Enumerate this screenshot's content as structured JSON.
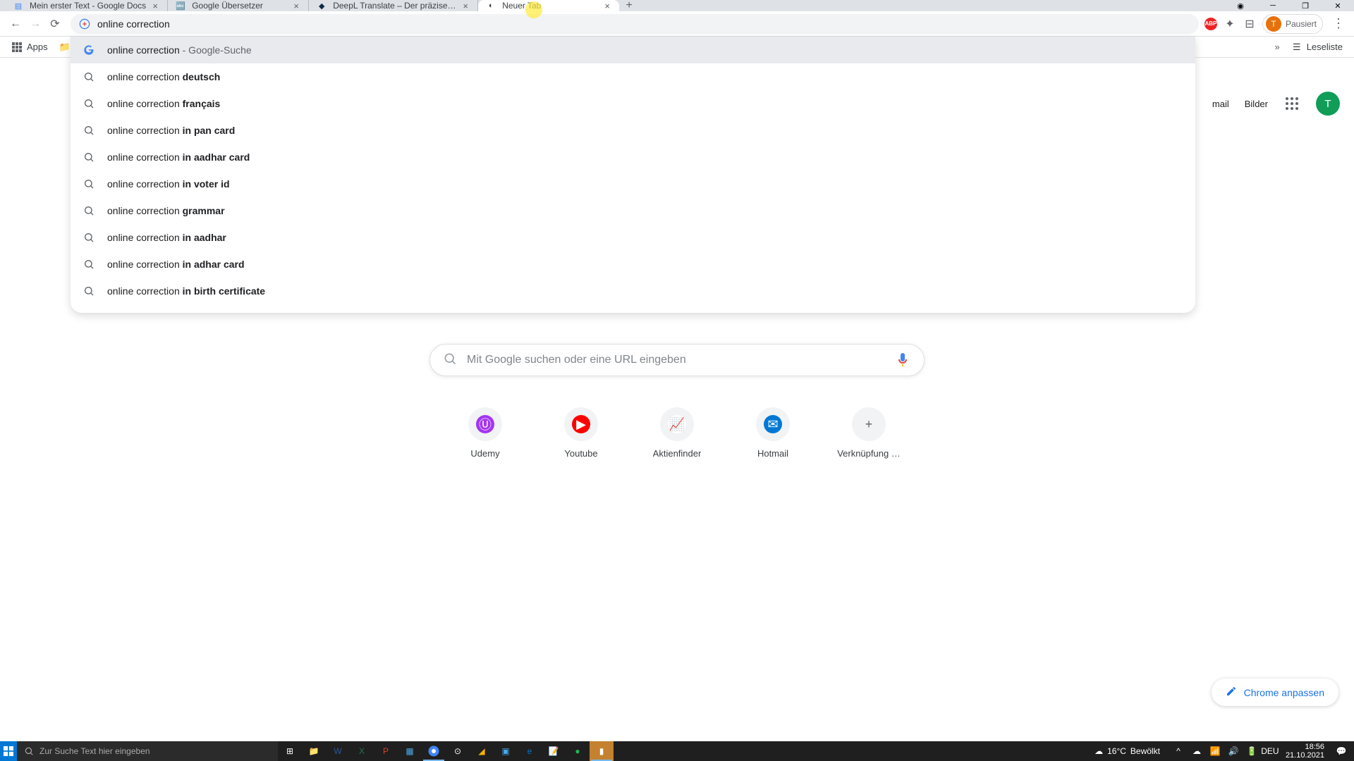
{
  "tabs": [
    {
      "title": "Mein erster Text - Google Docs",
      "favicon": "📄",
      "color": "#4285f4"
    },
    {
      "title": "Google Übersetzer",
      "favicon": "🔄",
      "color": "#4285f4"
    },
    {
      "title": "DeepL Translate – Der präziseste",
      "favicon": "◆",
      "color": "#0f2b46"
    },
    {
      "title": "Neuer Tab",
      "favicon": "G",
      "color": "#5f6368",
      "active": true
    }
  ],
  "address": {
    "value": "online correction"
  },
  "profile": {
    "initial": "T",
    "status": "Pausiert"
  },
  "bookmarks": {
    "apps": "Apps",
    "reader": "Leseliste"
  },
  "omnibox": {
    "rows": [
      {
        "base": "online correction",
        "suffix": " - Google-Suche",
        "isSearch": true,
        "selected": true
      },
      {
        "base": "online correction ",
        "bold": "deutsch"
      },
      {
        "base": "online correction ",
        "bold": "français"
      },
      {
        "base": "online correction ",
        "bold": "in pan card"
      },
      {
        "base": "online correction ",
        "bold": "in aadhar card"
      },
      {
        "base": "online correction ",
        "bold": "in voter id"
      },
      {
        "base": "online correction ",
        "bold": "grammar"
      },
      {
        "base": "online correction ",
        "bold": "in aadhar"
      },
      {
        "base": "online correction ",
        "bold": "in adhar card"
      },
      {
        "base": "online correction ",
        "bold": "in birth certificate"
      }
    ]
  },
  "toplinks": {
    "gmail": "Gmail",
    "images": "Bilder"
  },
  "search": {
    "placeholder": "Mit Google suchen oder eine URL eingeben"
  },
  "shortcuts": [
    {
      "label": "Udemy",
      "glyph": "Ⓤ",
      "bg": "#a435f0"
    },
    {
      "label": "Youtube",
      "glyph": "▶",
      "bg": "#ff0000"
    },
    {
      "label": "Aktienfinder",
      "glyph": "📈",
      "bg": "#fff"
    },
    {
      "label": "Hotmail",
      "glyph": "✉",
      "bg": "#0078d4"
    },
    {
      "label": "Verknüpfung …",
      "glyph": "+",
      "bg": "#f1f3f4",
      "add": true
    }
  ],
  "customize": "Chrome anpassen",
  "taskbar": {
    "search": "Zur Suche Text hier eingeben",
    "weather": {
      "temp": "16°C",
      "cond": "Bewölkt"
    },
    "lang": "DEU",
    "time": "18:56",
    "date": "21.10.2021"
  }
}
